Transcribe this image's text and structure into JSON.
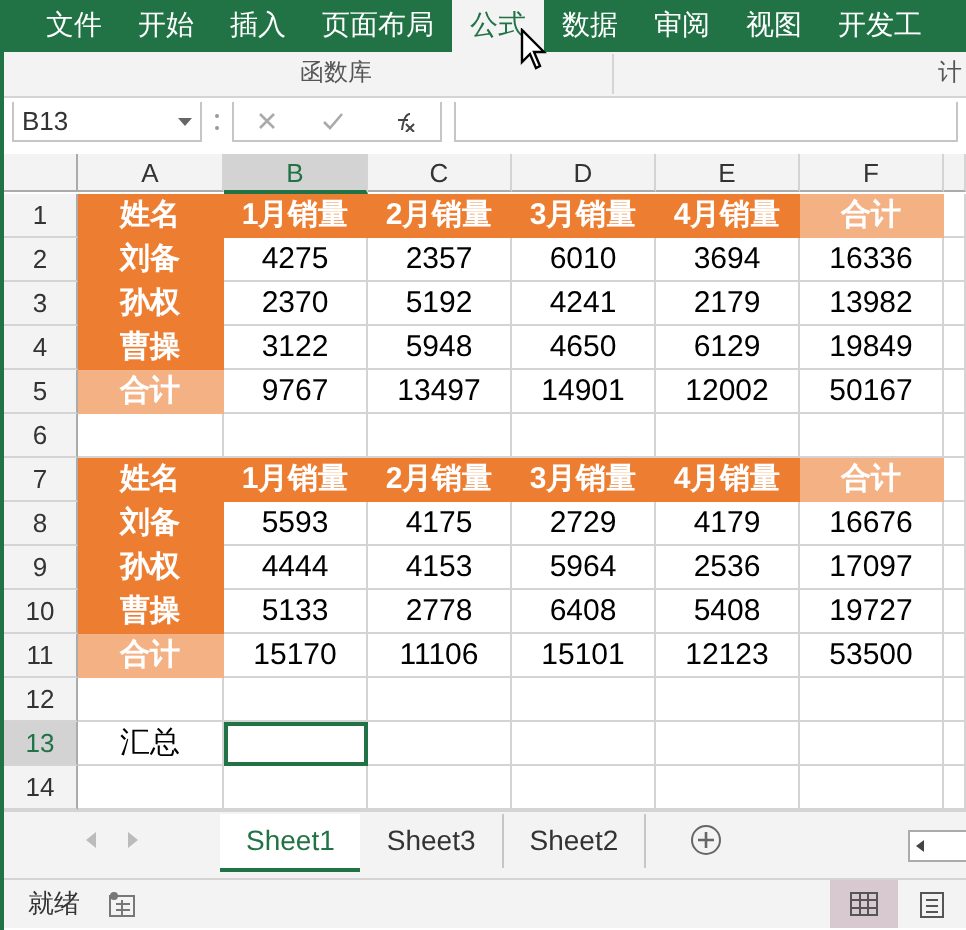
{
  "ribbon": {
    "tabs": [
      {
        "label": "文件",
        "selected": false
      },
      {
        "label": "开始",
        "selected": false
      },
      {
        "label": "插入",
        "selected": false
      },
      {
        "label": "页面布局",
        "selected": false
      },
      {
        "label": "公式",
        "selected": true
      },
      {
        "label": "数据",
        "selected": false
      },
      {
        "label": "审阅",
        "selected": false
      },
      {
        "label": "视图",
        "selected": false
      },
      {
        "label": "开发工",
        "selected": false
      }
    ],
    "group_label": "函数库",
    "next_group_label": "计"
  },
  "formula_bar": {
    "name_box": "B13"
  },
  "sheet": {
    "columns": [
      {
        "label": "A",
        "selected": false
      },
      {
        "label": "B",
        "selected": true
      },
      {
        "label": "C",
        "selected": false
      },
      {
        "label": "D",
        "selected": false
      },
      {
        "label": "E",
        "selected": false
      },
      {
        "label": "F",
        "selected": false
      }
    ],
    "rows": [
      {
        "number": "1",
        "selected": false,
        "cells": [
          {
            "text": "姓名",
            "kind": "head"
          },
          {
            "text": "1月销量",
            "kind": "head"
          },
          {
            "text": "2月销量",
            "kind": "head"
          },
          {
            "text": "3月销量",
            "kind": "head"
          },
          {
            "text": "4月销量",
            "kind": "head"
          },
          {
            "text": "合计",
            "kind": "total"
          }
        ]
      },
      {
        "number": "2",
        "selected": false,
        "cells": [
          {
            "text": "刘备",
            "kind": "head"
          },
          {
            "text": "4275",
            "kind": "value"
          },
          {
            "text": "2357",
            "kind": "value"
          },
          {
            "text": "6010",
            "kind": "value"
          },
          {
            "text": "3694",
            "kind": "value"
          },
          {
            "text": "16336",
            "kind": "value"
          }
        ]
      },
      {
        "number": "3",
        "selected": false,
        "cells": [
          {
            "text": "孙权",
            "kind": "head"
          },
          {
            "text": "2370",
            "kind": "value"
          },
          {
            "text": "5192",
            "kind": "value"
          },
          {
            "text": "4241",
            "kind": "value"
          },
          {
            "text": "2179",
            "kind": "value"
          },
          {
            "text": "13982",
            "kind": "value"
          }
        ]
      },
      {
        "number": "4",
        "selected": false,
        "cells": [
          {
            "text": "曹操",
            "kind": "head"
          },
          {
            "text": "3122",
            "kind": "value"
          },
          {
            "text": "5948",
            "kind": "value"
          },
          {
            "text": "4650",
            "kind": "value"
          },
          {
            "text": "6129",
            "kind": "value"
          },
          {
            "text": "19849",
            "kind": "value"
          }
        ]
      },
      {
        "number": "5",
        "selected": false,
        "cells": [
          {
            "text": "合计",
            "kind": "total"
          },
          {
            "text": "9767",
            "kind": "value"
          },
          {
            "text": "13497",
            "kind": "value"
          },
          {
            "text": "14901",
            "kind": "value"
          },
          {
            "text": "12002",
            "kind": "value"
          },
          {
            "text": "50167",
            "kind": "value"
          }
        ]
      },
      {
        "number": "6",
        "selected": false,
        "cells": []
      },
      {
        "number": "7",
        "selected": false,
        "cells": [
          {
            "text": "姓名",
            "kind": "head"
          },
          {
            "text": "1月销量",
            "kind": "head"
          },
          {
            "text": "2月销量",
            "kind": "head"
          },
          {
            "text": "3月销量",
            "kind": "head"
          },
          {
            "text": "4月销量",
            "kind": "head"
          },
          {
            "text": "合计",
            "kind": "total"
          }
        ]
      },
      {
        "number": "8",
        "selected": false,
        "cells": [
          {
            "text": "刘备",
            "kind": "head"
          },
          {
            "text": "5593",
            "kind": "value"
          },
          {
            "text": "4175",
            "kind": "value"
          },
          {
            "text": "2729",
            "kind": "value"
          },
          {
            "text": "4179",
            "kind": "value"
          },
          {
            "text": "16676",
            "kind": "value"
          }
        ]
      },
      {
        "number": "9",
        "selected": false,
        "cells": [
          {
            "text": "孙权",
            "kind": "head"
          },
          {
            "text": "4444",
            "kind": "value"
          },
          {
            "text": "4153",
            "kind": "value"
          },
          {
            "text": "5964",
            "kind": "value"
          },
          {
            "text": "2536",
            "kind": "value"
          },
          {
            "text": "17097",
            "kind": "value"
          }
        ]
      },
      {
        "number": "10",
        "selected": false,
        "cells": [
          {
            "text": "曹操",
            "kind": "head"
          },
          {
            "text": "5133",
            "kind": "value"
          },
          {
            "text": "2778",
            "kind": "value"
          },
          {
            "text": "6408",
            "kind": "value"
          },
          {
            "text": "5408",
            "kind": "value"
          },
          {
            "text": "19727",
            "kind": "value"
          }
        ]
      },
      {
        "number": "11",
        "selected": false,
        "cells": [
          {
            "text": "合计",
            "kind": "total"
          },
          {
            "text": "15170",
            "kind": "value"
          },
          {
            "text": "11106",
            "kind": "value"
          },
          {
            "text": "15101",
            "kind": "value"
          },
          {
            "text": "12123",
            "kind": "value"
          },
          {
            "text": "53500",
            "kind": "value"
          }
        ]
      },
      {
        "number": "12",
        "selected": false,
        "cells": []
      },
      {
        "number": "13",
        "selected": true,
        "cells": [
          {
            "text": "汇总",
            "kind": "value"
          }
        ]
      },
      {
        "number": "14",
        "selected": false,
        "cells": []
      }
    ]
  },
  "sheet_tabs": [
    {
      "label": "Sheet1",
      "selected": true
    },
    {
      "label": "Sheet3",
      "selected": false
    },
    {
      "label": "Sheet2",
      "selected": false
    }
  ],
  "status_bar": {
    "text": "就绪"
  }
}
